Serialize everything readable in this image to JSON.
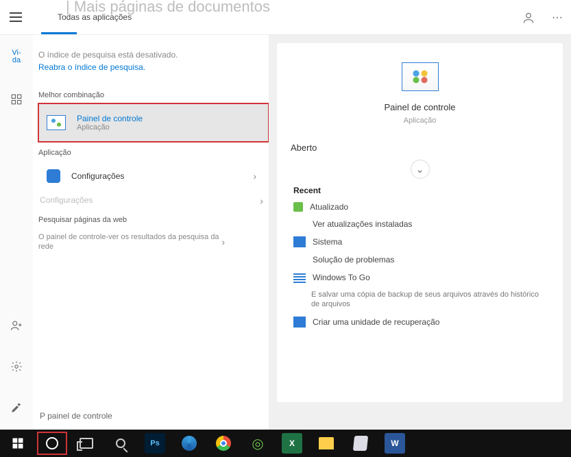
{
  "top": {
    "tab_all_apps": "Todas as aplicações",
    "ghost_heading": "| Mais páginas de documentos"
  },
  "rail": {
    "view_label": "Vi-\nda"
  },
  "index": {
    "disabled_msg": "O índice de pesquisa está desativado.",
    "reopen_link": "Reabra o índice de pesquisa."
  },
  "sections": {
    "best_match": "Melhor combinação",
    "application": "Aplicação",
    "web": "Pesquisar páginas da web"
  },
  "best_match": {
    "title": "Painel de controle",
    "subtitle": "Aplicação"
  },
  "apps": {
    "settings_label": "Configurações",
    "ghost_settings": "Configurações"
  },
  "web": {
    "item1": "O painel de controle-ver os resultados da pesquisa da rede"
  },
  "preview": {
    "title": "Painel de controle",
    "subtitle": "Aplicação",
    "open_label": "Aberto",
    "recent_header": "Recent",
    "recent_items": [
      "Atualizado",
      "Ver atualizações instaladas",
      "Sistema",
      "Solução de problemas",
      "Windows To Go",
      "E salvar uma cópia de backup de seus arquivos através do histórico de arquivos",
      "Criar uma unidade de recuperação"
    ]
  },
  "search": {
    "value": "P painel de controle"
  },
  "taskbar": {
    "apps": [
      "start",
      "cortana",
      "task-view",
      "magnifier",
      "photoshop",
      "edge",
      "chrome",
      "dreamweaver",
      "excel",
      "file-explorer",
      "notepad",
      "word"
    ]
  }
}
